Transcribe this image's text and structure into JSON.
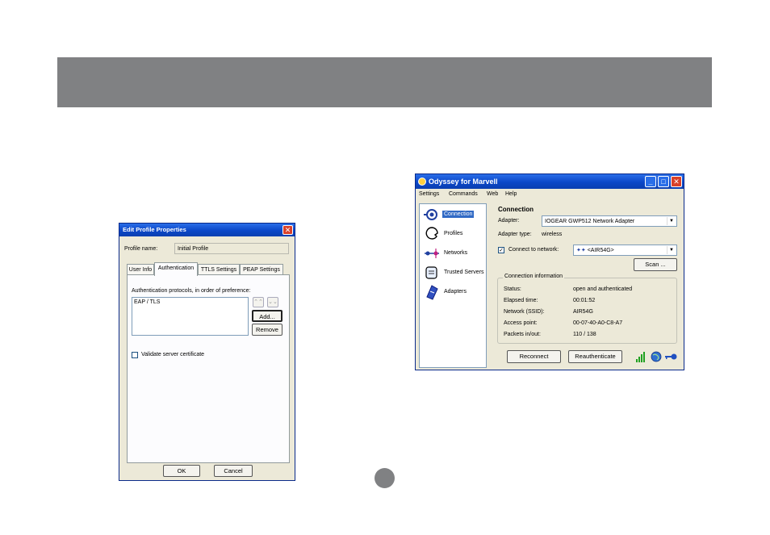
{
  "edit_profile": {
    "title": "Edit Profile Properties",
    "close_glyph": "✕",
    "profile_name_label": "Profile name:",
    "profile_name_value": "Initial Profile",
    "tabs": [
      {
        "label": "User Info"
      },
      {
        "label": "Authentication"
      },
      {
        "label": "TTLS Settings"
      },
      {
        "label": "PEAP Settings"
      }
    ],
    "protocols_label": "Authentication protocols, in order of preference:",
    "protocols": [
      "EAP / TLS"
    ],
    "up_glyph": "⌃⌃",
    "down_glyph": "⌄⌄",
    "add_label": "Add...",
    "remove_label": "Remove",
    "validate_label": "Validate server certificate",
    "ok_label": "OK",
    "cancel_label": "Cancel"
  },
  "odyssey": {
    "title": "Odyssey for Marvell",
    "minimize_glyph": "_",
    "maximize_glyph": "□",
    "close_glyph": "✕",
    "menu": [
      "Settings",
      "Commands",
      "Web",
      "Help"
    ],
    "nav": [
      {
        "label": "Connection",
        "icon": "connection-icon"
      },
      {
        "label": "Profiles",
        "icon": "profiles-icon"
      },
      {
        "label": "Networks",
        "icon": "networks-icon"
      },
      {
        "label": "Trusted Servers",
        "icon": "trusted-servers-icon"
      },
      {
        "label": "Adapters",
        "icon": "adapters-icon"
      }
    ],
    "section_title": "Connection",
    "adapter_label": "Adapter:",
    "adapter_value": "IOGEAR GWP512 Network Adapter",
    "adapter_type_label": "Adapter type:",
    "adapter_type_value": "wireless",
    "connect_label": "Connect to network:",
    "network_value": "<AIR54G>",
    "network_icon_glyph": "✦✦",
    "dropdown_glyph": "▼",
    "scan_label": "Scan ...",
    "info_title": "Connection information",
    "info": [
      {
        "label": "Status:",
        "value": "open and authenticated"
      },
      {
        "label": "Elapsed time:",
        "value": "00:01:52"
      },
      {
        "label": "Network (SSID):",
        "value": "AIR54G"
      },
      {
        "label": "Access point:",
        "value": "00-07-40-A0-C8-A7"
      },
      {
        "label": "Packets in/out:",
        "value": "110 / 138"
      }
    ],
    "reconnect_label": "Reconnect",
    "reauth_label": "Reauthenticate",
    "check_glyph": "✓"
  },
  "colors": {
    "banner": "#808183",
    "titlebar": "#0b47c8",
    "selection": "#316ac5"
  }
}
